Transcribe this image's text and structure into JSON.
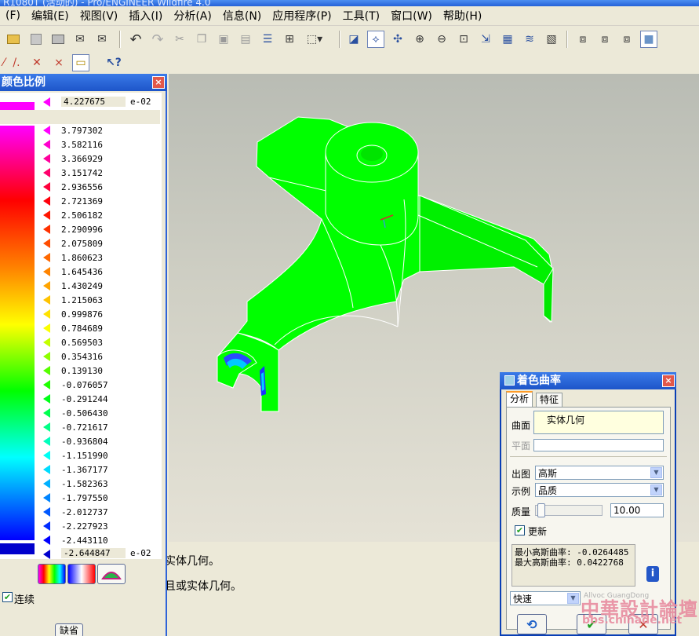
{
  "window": {
    "title": "R1080T (活动的) - Pro/ENGINEER Wildfire 4.0"
  },
  "menu": [
    {
      "label": "(F)"
    },
    {
      "label": "编辑(E)"
    },
    {
      "label": "视图(V)"
    },
    {
      "label": "插入(I)"
    },
    {
      "label": "分析(A)"
    },
    {
      "label": "信息(N)"
    },
    {
      "label": "应用程序(P)"
    },
    {
      "label": "工具(T)"
    },
    {
      "label": "窗口(W)"
    },
    {
      "label": "帮助(H)"
    }
  ],
  "scale_panel": {
    "title": "颜色比例",
    "close_label": "×",
    "top_value": "4.227675",
    "top_exponent": "e-02",
    "values": [
      "3.797302",
      "3.582116",
      "3.366929",
      "3.151742",
      "2.936556",
      "2.721369",
      "2.506182",
      "2.290996",
      "2.075809",
      "1.860623",
      "1.645436",
      "1.430249",
      "1.215063",
      "0.999876",
      "0.784689",
      "0.569503",
      "0.354316",
      "0.139130",
      "-0.076057",
      "-0.291244",
      "-0.506430",
      "-0.721617",
      "-0.936804",
      "-1.151990",
      "-1.367177",
      "-1.582363",
      "-1.797550",
      "-2.012737",
      "-2.227923",
      "-2.443110"
    ],
    "bottom_value": "-2.644847",
    "bottom_exponent": "e-02",
    "continuous_label": "连续",
    "continuous_checked": true,
    "default_button": "缺省"
  },
  "messages": {
    "line1": "实体几何。",
    "line2": "且或实体几何。"
  },
  "curvature_dialog": {
    "title": "着色曲率",
    "close_label": "×",
    "tabs": [
      "分析",
      "特征"
    ],
    "surface_label": "曲面",
    "surface_value": "实体几何",
    "plane_label": "平面",
    "plot_label": "出图",
    "plot_value": "高斯",
    "example_label": "示例",
    "example_value": "品质",
    "quality_label": "质量",
    "quality_value": "10.00",
    "update_label": "更新",
    "update_checked": true,
    "result_min": "最小高斯曲率: -0.0264485",
    "result_max": "最大高斯曲率: 0.0422768",
    "mode_value": "快速",
    "info_icon": "i"
  },
  "watermark": {
    "line1": "中華設計論壇",
    "line2": "bbs.chinade.net",
    "logo_text": "Allvoc GuangDong"
  },
  "colors": {
    "titlebar": "#2561d8",
    "model_green": "#00ff00",
    "panel_bg": "#ece9d8"
  }
}
